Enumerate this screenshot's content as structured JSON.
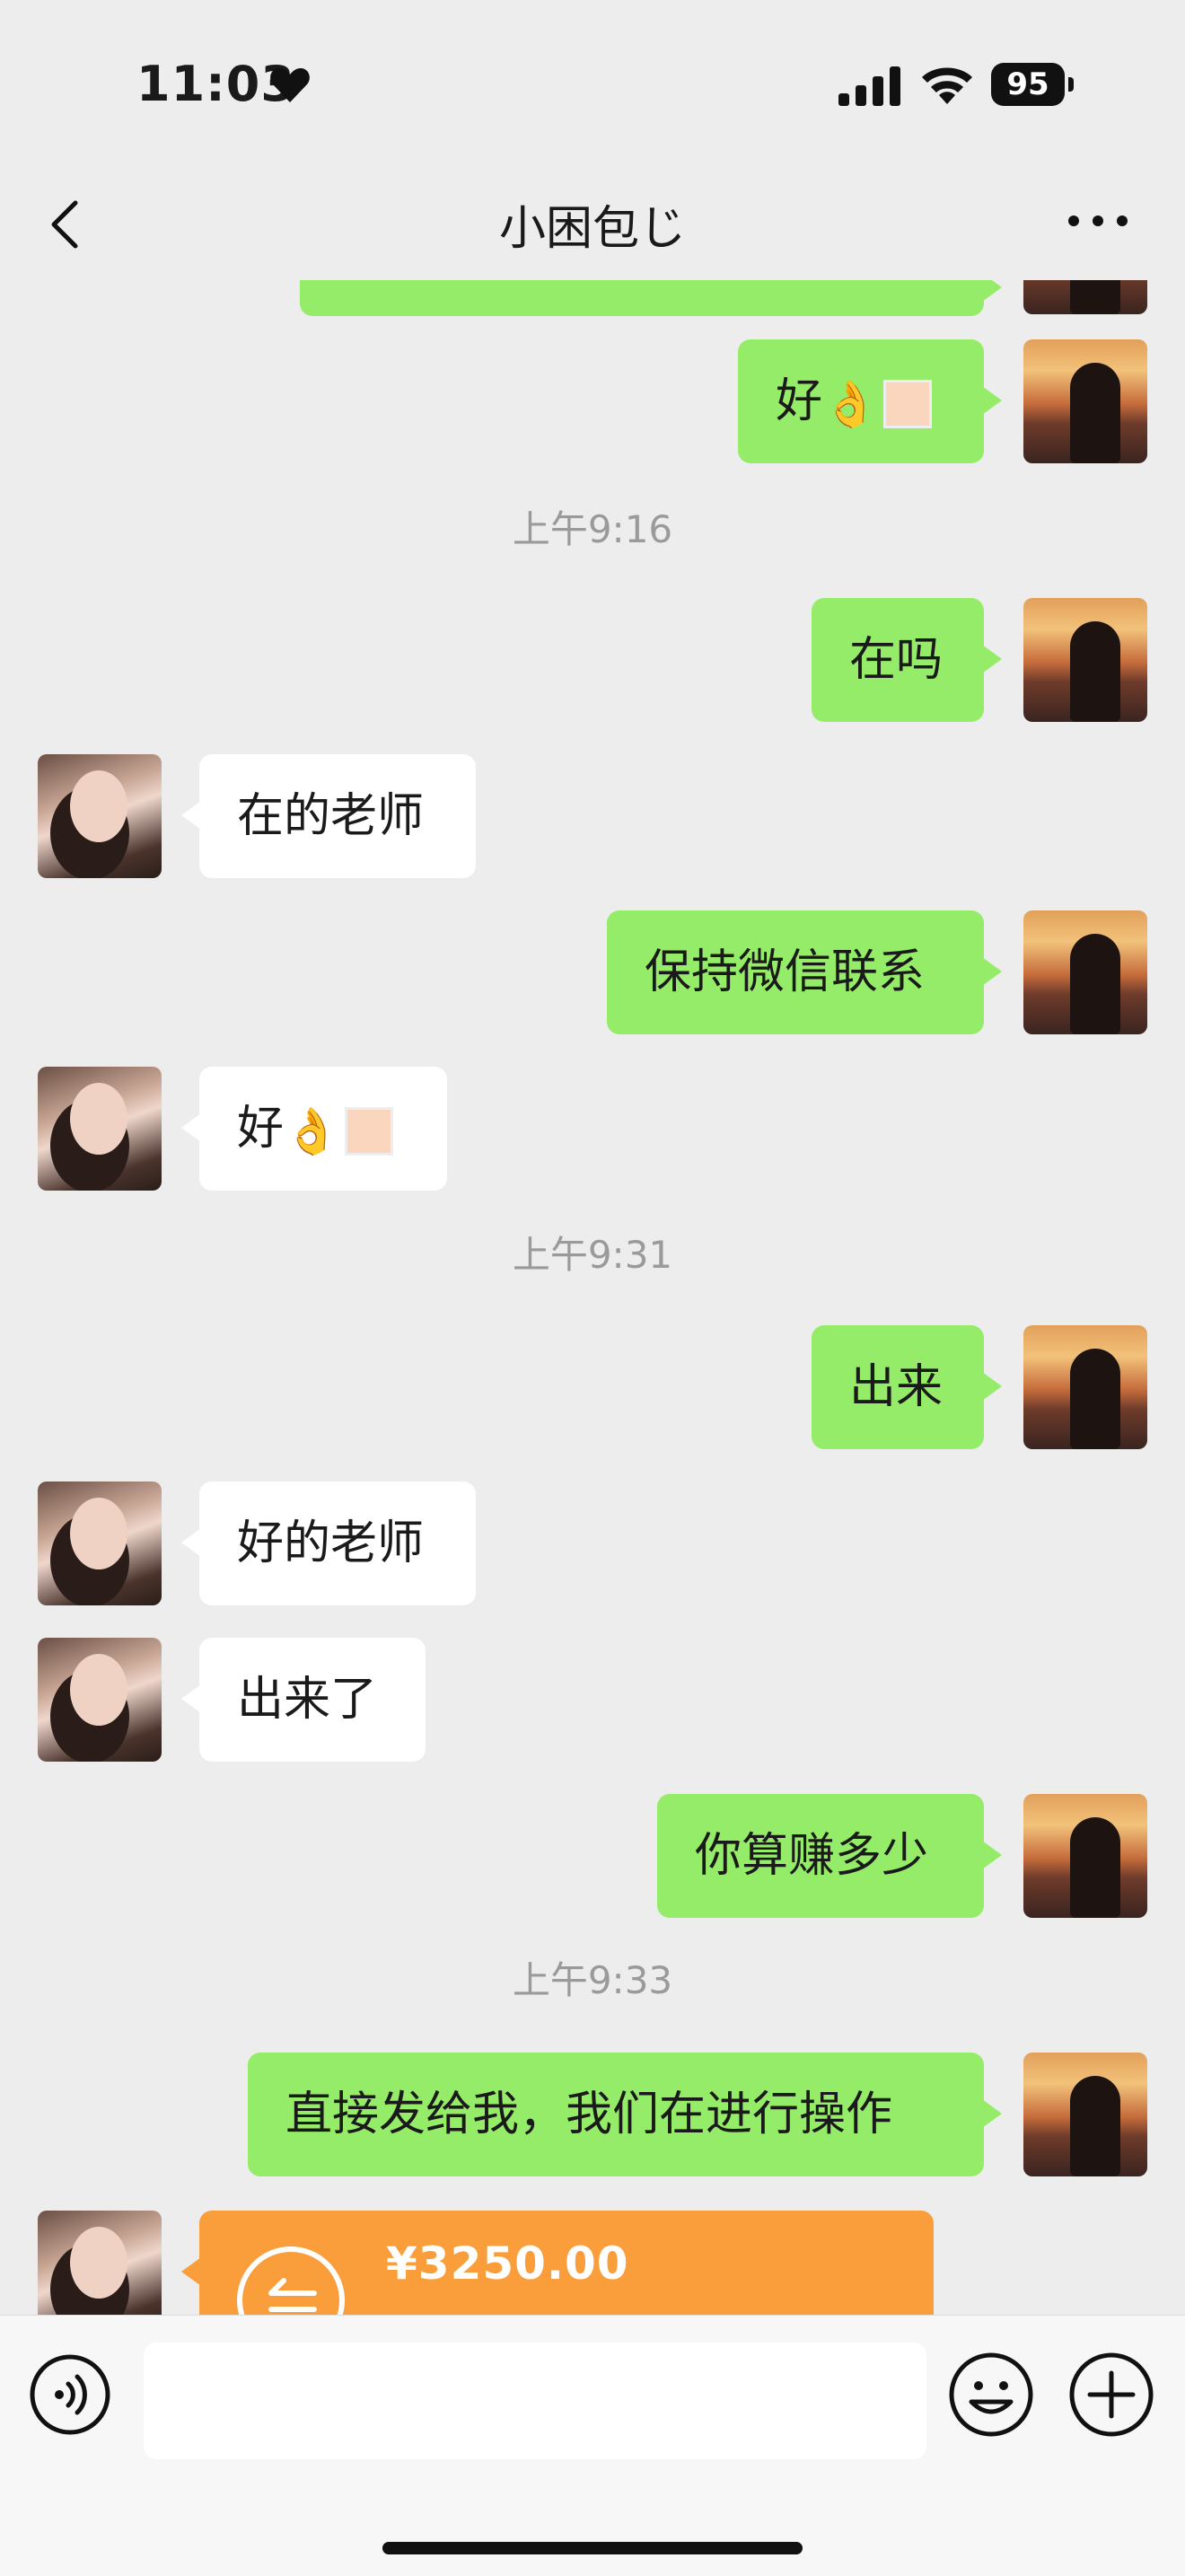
{
  "status_bar": {
    "time": "11:03",
    "battery": "95"
  },
  "nav": {
    "title": "小困包じ"
  },
  "messages": {
    "m1": {
      "prefix": "好"
    },
    "ts1": "上午9:16",
    "m2": "在吗",
    "m3": "在的老师",
    "m4": "保持微信联系",
    "m5": {
      "prefix": "好"
    },
    "ts2": "上午9:31",
    "m6": "出来",
    "m7": "好的老师",
    "m8": "出来了",
    "m9": "你算赚多少",
    "ts3": "上午9:33",
    "m10": "直接发给我，我们在进行操作",
    "transfer": {
      "amount": "¥3250.00"
    }
  },
  "colors": {
    "self_bubble": "#95ec69",
    "other_bubble": "#ffffff",
    "transfer": "#fa9d3b",
    "background": "#ededed"
  },
  "icons": [
    "back-chevron-icon",
    "more-icon",
    "voice-icon",
    "emoji-icon",
    "plus-icon",
    "heart-icon",
    "signal-icon",
    "wifi-icon",
    "battery-icon",
    "transfer-icon"
  ]
}
